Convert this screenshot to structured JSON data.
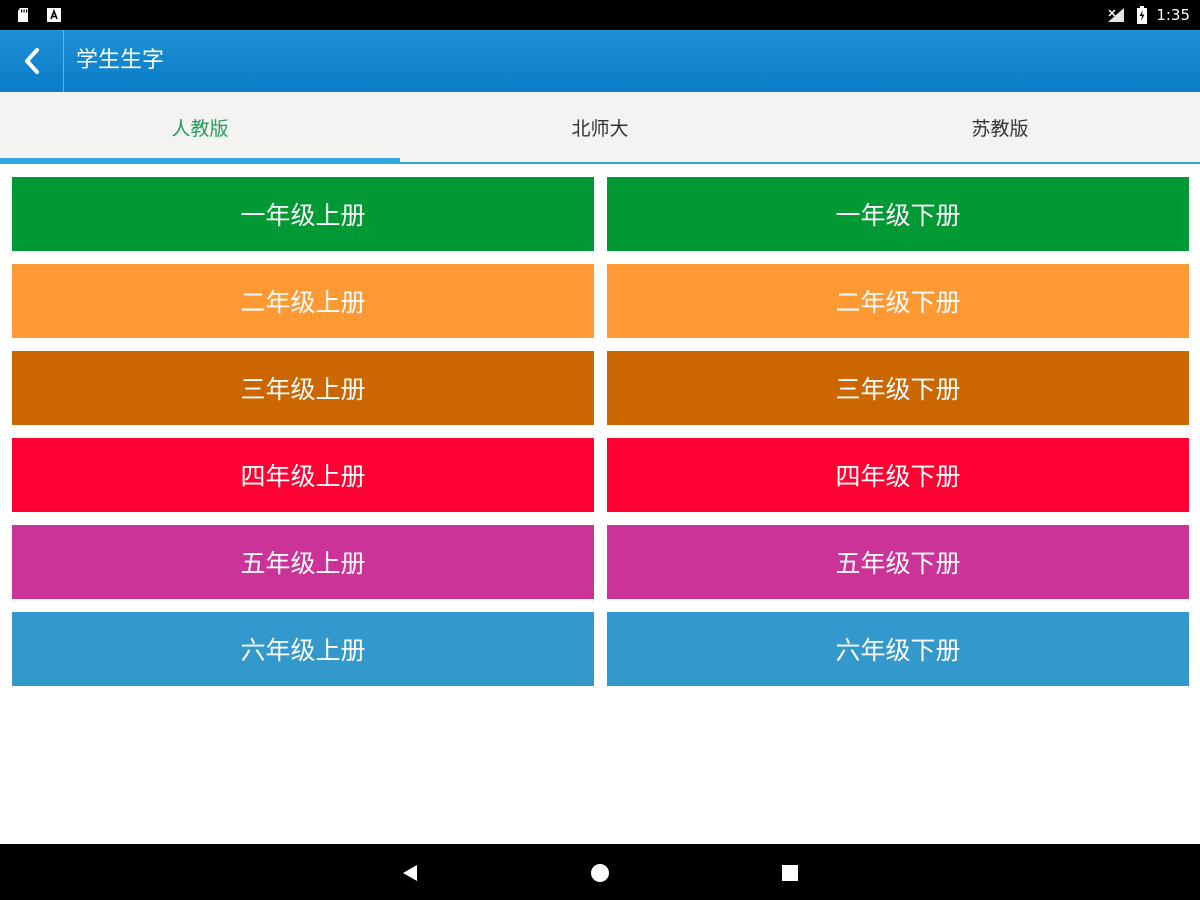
{
  "status_bar": {
    "time": "1:35",
    "icons": [
      "sd-card-icon",
      "a-notification-icon",
      "signal-icon",
      "battery-icon"
    ]
  },
  "app_bar": {
    "title": "学生生字",
    "back_icon": "chevron-left-icon"
  },
  "tabs": [
    {
      "label": "人教版",
      "active": true
    },
    {
      "label": "北师大",
      "active": false
    },
    {
      "label": "苏教版",
      "active": false
    }
  ],
  "grade_buttons": [
    {
      "label": "一年级上册",
      "color": "#009933"
    },
    {
      "label": "一年级下册",
      "color": "#009933"
    },
    {
      "label": "二年级上册",
      "color": "#ff9933"
    },
    {
      "label": "二年级下册",
      "color": "#ff9933"
    },
    {
      "label": "三年级上册",
      "color": "#cc6600"
    },
    {
      "label": "三年级下册",
      "color": "#cc6600"
    },
    {
      "label": "四年级上册",
      "color": "#ff0033"
    },
    {
      "label": "四年级下册",
      "color": "#ff0033"
    },
    {
      "label": "五年级上册",
      "color": "#cc3399"
    },
    {
      "label": "五年级下册",
      "color": "#cc3399"
    },
    {
      "label": "六年级上册",
      "color": "#3399cc"
    },
    {
      "label": "六年级下册",
      "color": "#3399cc"
    }
  ],
  "colors": {
    "app_bar": "#0b7dc8",
    "tab_active_text": "#1fa05a",
    "tab_indicator": "#2fa8e0"
  },
  "nav_bar": {
    "icons": [
      "back-triangle-icon",
      "home-circle-icon",
      "recents-square-icon"
    ]
  }
}
